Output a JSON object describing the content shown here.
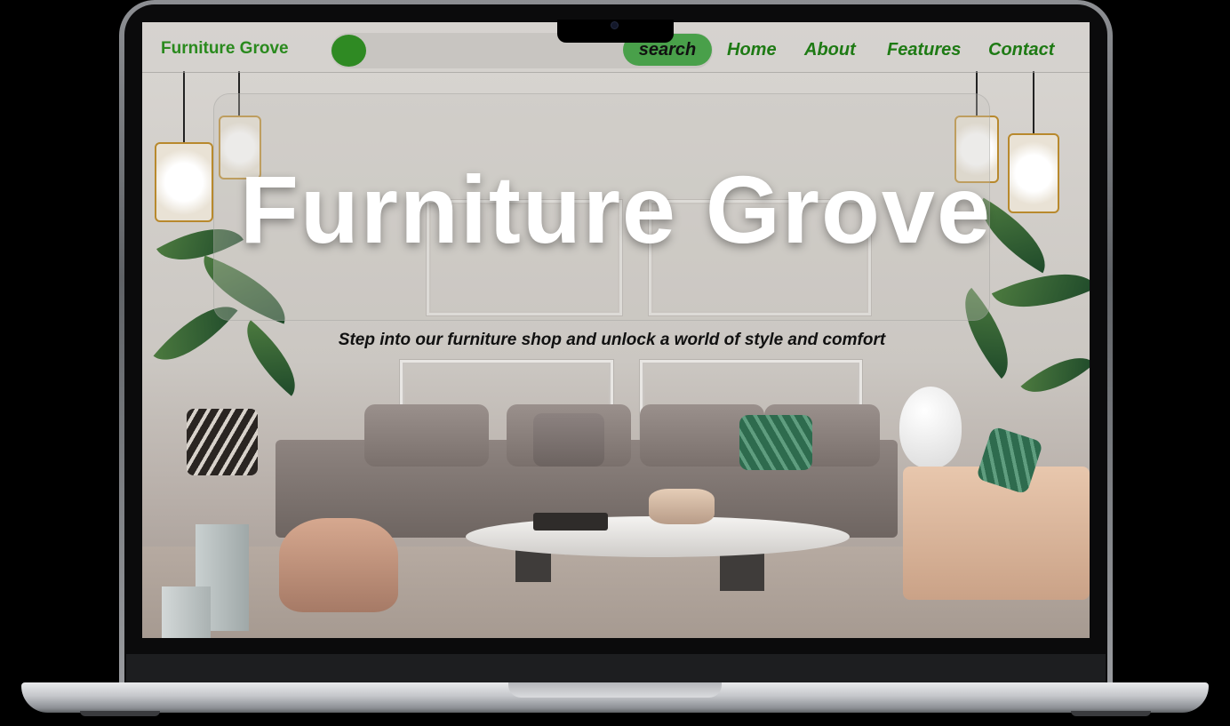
{
  "nav": {
    "brand": "Furniture Grove",
    "search_button": "search",
    "links": [
      "Home",
      "About",
      "Features",
      "Contact"
    ]
  },
  "hero": {
    "title": "Furniture Grove",
    "tagline": "Step into our furniture shop and unlock a world of style and comfort"
  },
  "colors": {
    "brand_green": "#2a8a1e",
    "button_green": "#49a04a"
  }
}
